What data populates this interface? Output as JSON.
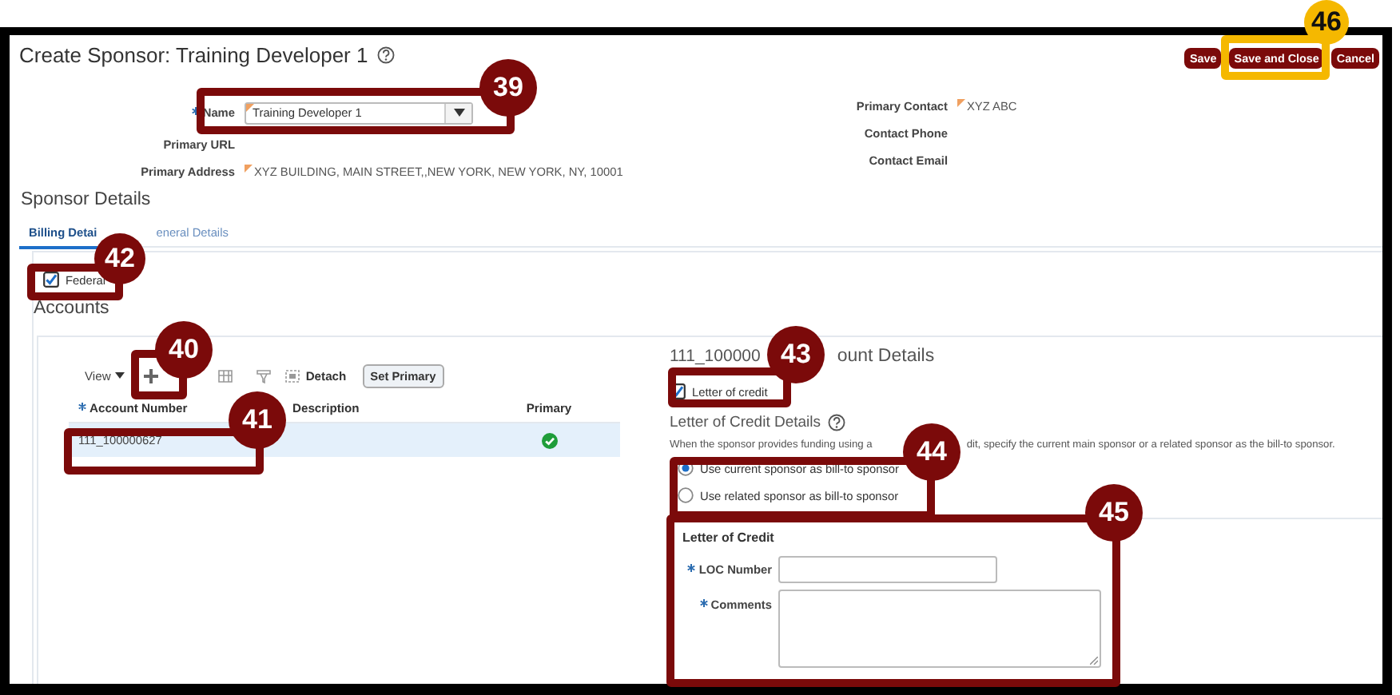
{
  "window": {
    "title": "Create Sponsor: Training Developer 1"
  },
  "actions": [
    {
      "label": "Save"
    },
    {
      "label": "Save and Close"
    },
    {
      "label": "Cancel"
    }
  ],
  "fields_left": [
    {
      "label": "Name",
      "value": "Training Developer 1",
      "required": true,
      "kind": "select"
    },
    {
      "label": "Primary URL",
      "kind": "text"
    },
    {
      "label": "Primary Address",
      "value": "XYZ BUILDING, MAIN STREET,,NEW YORK, NEW YORK, NY, 10001",
      "kind": "text"
    }
  ],
  "fields_right": [
    {
      "label": "Primary Contact",
      "value": "XYZ ABC",
      "kind": "text"
    },
    {
      "label": "Contact Phone",
      "kind": "text"
    },
    {
      "label": "Contact Email",
      "kind": "text"
    }
  ],
  "section_title": "Sponsor Details",
  "tabs": [
    {
      "label": "Billing Detai",
      "selected": true
    },
    {
      "label": "eneral Details",
      "selected": false
    }
  ],
  "federal": {
    "label": "Federal",
    "checked": true
  },
  "accounts": {
    "title": "Accounts",
    "view_label": "View",
    "detach_label": "Detach",
    "set_primary_label": "Set Primary",
    "columns": [
      {
        "label": "Account Number",
        "required": true
      },
      {
        "label": "Description",
        "required": false
      },
      {
        "label": "Primary",
        "required": false
      }
    ],
    "rows": [
      {
        "account_number": "111_100000627",
        "primary": true,
        "selected": true
      }
    ]
  },
  "details": {
    "title_parts": [
      "111_100000",
      "ount Details"
    ],
    "letter_of_credit": {
      "label": "Letter of credit",
      "checked": true
    },
    "loc_title": "Letter of Credit Details",
    "note_parts": [
      "When the sponsor provides funding using a",
      "dit, specify the current main sponsor or a related sponsor as the bill-to sponsor."
    ],
    "options": [
      {
        "label": "Use current sponsor as bill-to sponsor",
        "selected": true
      },
      {
        "label": "Use related sponsor as bill-to sponsor",
        "selected": false
      }
    ],
    "loc_section": {
      "title": "Letter of Credit",
      "fields": [
        {
          "label": "LOC Number",
          "required": true,
          "kind": "input"
        },
        {
          "label": "Comments",
          "required": true,
          "kind": "textarea"
        }
      ]
    }
  },
  "callouts": [
    {
      "number": "39",
      "color": "#7b0a0a"
    },
    {
      "number": "46",
      "color": "#f5b800"
    },
    {
      "number": "42",
      "color": "#7b0a0a"
    },
    {
      "number": "40",
      "color": "#7b0a0a"
    },
    {
      "number": "41",
      "color": "#7b0a0a"
    },
    {
      "number": "43",
      "color": "#7b0a0a"
    },
    {
      "number": "44",
      "color": "#7b0a0a"
    },
    {
      "number": "45",
      "color": "#7b0a0a"
    }
  ]
}
